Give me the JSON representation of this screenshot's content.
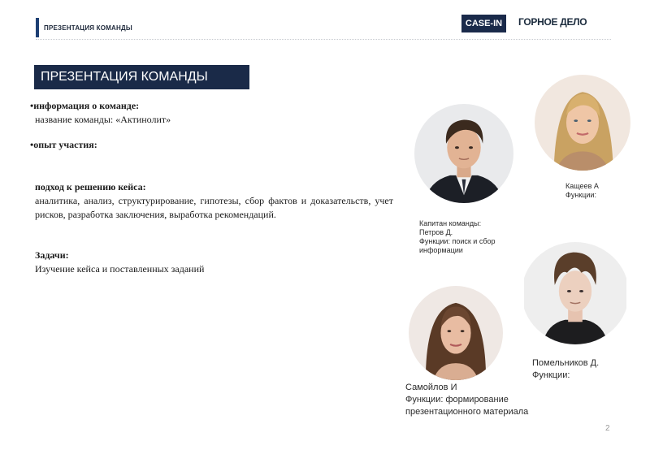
{
  "header": {
    "section": "ПРЕЗЕНТАЦИЯ КОМАНДЫ",
    "badge": "CASE-IN",
    "sector": "ГОРНОЕ ДЕЛО"
  },
  "slide": {
    "title": "ПРЕЗЕНТАЦИЯ КОМАНДЫ",
    "info_heading": "•информация о команде:",
    "info_text": "название команды: «Актинолит»",
    "experience_heading": "•опыт участия:",
    "approach_heading": "подход к решению кейса:",
    "approach_text": "аналитика, анализ, структурирование, гипотезы, сбор фактов и доказательств, учет рисков, разработка заключения, выработка рекомендаций.",
    "tasks_heading": "Задачи:",
    "tasks_text": "Изучение кейса и поставленных заданий"
  },
  "members": [
    {
      "line1": "Капитан команды:",
      "line2": "Петров  Д.",
      "line3": "Функции: поиск и сбор",
      "line4": "информации",
      "photo_icon": "portrait-man-dark-hair"
    },
    {
      "line1": "Кащеев  А",
      "line2": "Функции:",
      "photo_icon": "portrait-woman-blonde"
    },
    {
      "line1": "Помельников Д.",
      "line2": "Функции:",
      "photo_icon": "portrait-man-tousled-hair"
    },
    {
      "line1": "Самойлов И",
      "line2": "Функции: формирование",
      "line3": "презентационного материала",
      "photo_icon": "portrait-woman-brunette"
    }
  ],
  "page_number": "2",
  "colors": {
    "navy": "#1a2a48",
    "accent_bar": "#1d3f73"
  }
}
